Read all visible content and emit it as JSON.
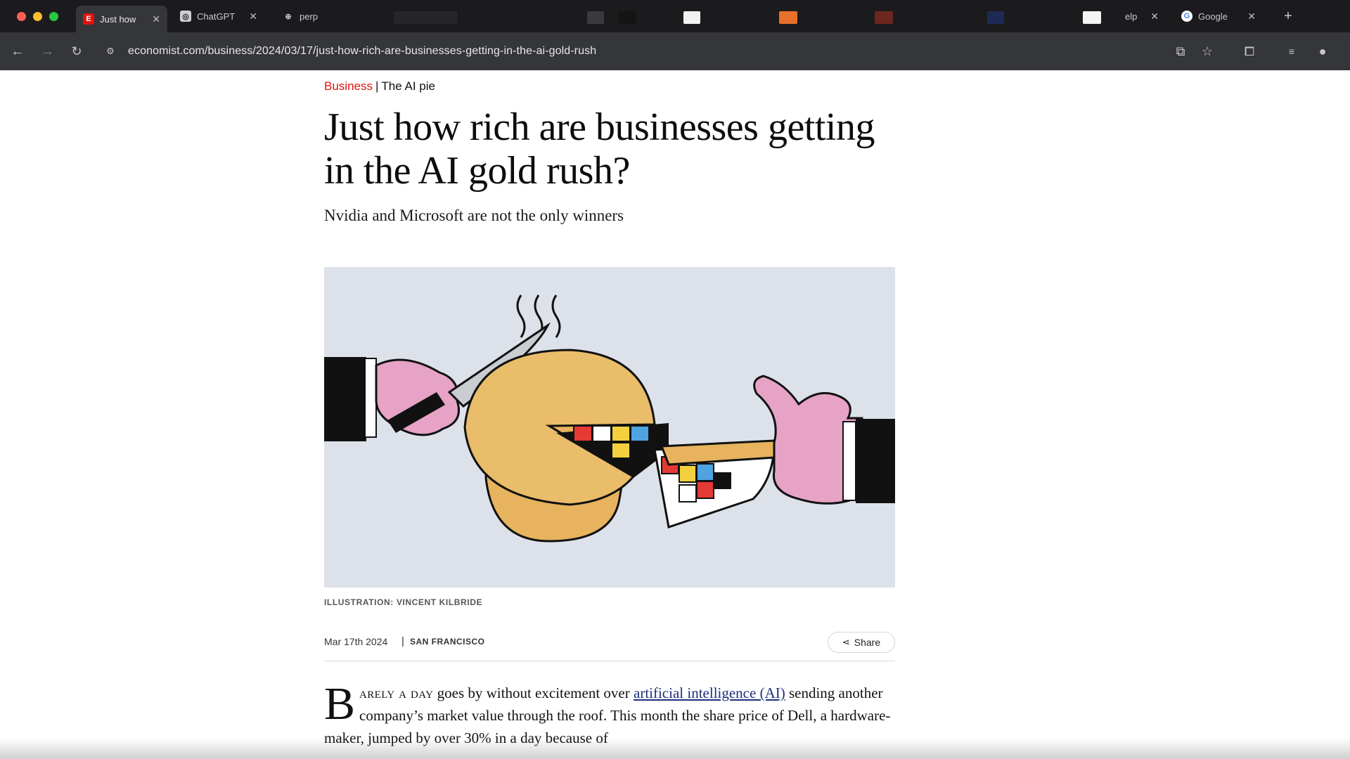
{
  "browser": {
    "tabs": [
      {
        "label": "Just how",
        "favicon": "E",
        "favicon_color": "#e3120b",
        "active": true
      },
      {
        "label": "ChatGPT",
        "favicon": "◎",
        "favicon_color": "#555555",
        "active": false
      },
      {
        "label": "perp",
        "favicon": "⊕",
        "favicon_color": "#555555",
        "active": false
      },
      {
        "label": "elp",
        "favicon": "",
        "favicon_color": "#555555",
        "active": false
      },
      {
        "label": "Google",
        "favicon": "G",
        "favicon_color": "#4285f4",
        "active": false
      }
    ],
    "url": "economist.com/business/2024/03/17/just-how-rich-are-businesses-getting-in-the-ai-gold-rush",
    "icons": {
      "back": "arrow-left-icon",
      "forward": "arrow-right-icon",
      "reload": "reload-icon",
      "site_info": "site-settings-icon",
      "cast": "screen-cast-icon",
      "bookmark": "star-icon",
      "extensions": "puzzle-icon",
      "profile": "person-icon",
      "new_tab": "plus-icon",
      "close": "close-icon"
    }
  },
  "article": {
    "section": "Business",
    "separator": "|",
    "topic": "The AI pie",
    "headline": "Just how rich are businesses getting in the AI gold rush?",
    "standfirst": "Nvidia and Microsoft are not the only winners",
    "image_caption": "ILLUSTRATION: VINCENT KILBRIDE",
    "date": "Mar 17th 2024",
    "meta_separator": "|",
    "location": "SAN FRANCISCO",
    "share_label": "Share",
    "body": {
      "dropcap": "B",
      "lead_smallcaps": "ARELY A DAY",
      "text_1": " goes by without excitement over ",
      "link_text": "artificial intelligence (AI)",
      "text_2": " sending another company’s market value through the roof. This month the share price of Dell, a hardware-maker, jumped by over 30% in a day because of"
    }
  },
  "colors": {
    "brand_red": "#e3120b",
    "link_blue": "#1f2e7a",
    "chrome_dark": "#202124"
  }
}
